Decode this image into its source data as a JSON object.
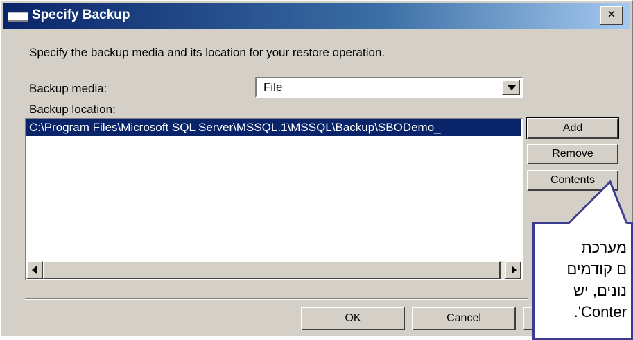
{
  "window": {
    "title": "Specify Backup",
    "close_label": "×"
  },
  "instruction": "Specify the backup media and its location for your restore operation.",
  "backup_media": {
    "label": "Backup media:",
    "value": "File"
  },
  "backup_location": {
    "label": "Backup location:",
    "items": [
      "C:\\Program Files\\Microsoft SQL Server\\MSSQL.1\\MSSQL\\Backup\\SBODemo_"
    ]
  },
  "side_buttons": {
    "add": "Add",
    "remove": "Remove",
    "contents": "Contents"
  },
  "footer_buttons": {
    "ok": "OK",
    "cancel": "Cancel"
  },
  "callout": {
    "line1": "מערכת",
    "line2": "ם קודמים",
    "line3": "נונים, יש",
    "line4": "Conter'."
  },
  "colors": {
    "titlebar": "#0a246a",
    "selection": "#0a246a",
    "callout_border": "#3b3b8f",
    "dialog_bg": "#d4d0c8"
  }
}
